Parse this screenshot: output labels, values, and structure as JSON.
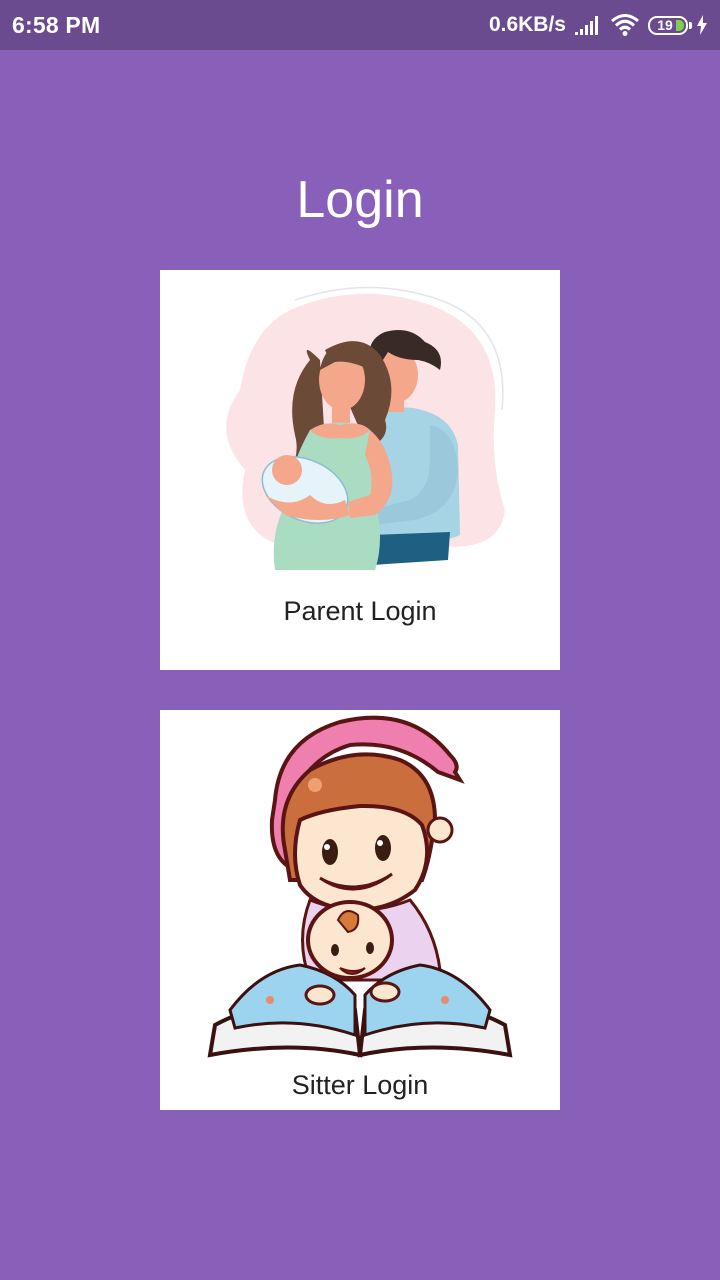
{
  "status_bar": {
    "time": "6:58 PM",
    "net_speed": "0.6KB/s",
    "battery_level": "19",
    "icons": [
      "signal-icon",
      "wifi-icon",
      "battery-icon",
      "charging-icon"
    ]
  },
  "page": {
    "title": "Login"
  },
  "cards": {
    "parent": {
      "label": "Parent Login",
      "image": "parent-family-illustration"
    },
    "sitter": {
      "label": "Sitter Login",
      "image": "sitter-baby-book-illustration"
    }
  },
  "colors": {
    "background": "#8860BA",
    "status_bar": "#6A4B90",
    "card": "#FFFFFF",
    "battery_fill": "#7CD04B"
  }
}
